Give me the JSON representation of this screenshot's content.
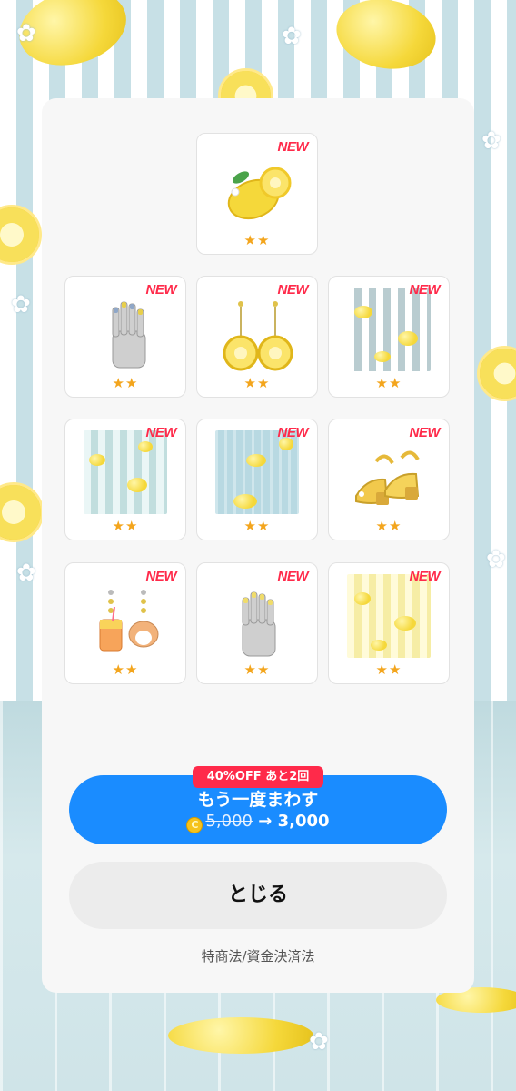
{
  "items": [
    {
      "badge": "NEW",
      "rarity": "★★",
      "icon": "lemon-icon"
    },
    {
      "badge": "NEW",
      "rarity": "★★",
      "icon": "nail-hand-icon"
    },
    {
      "badge": "NEW",
      "rarity": "★★",
      "icon": "lemon-earrings-icon"
    },
    {
      "badge": "NEW",
      "rarity": "★★",
      "icon": "striped-wallpaper-icon"
    },
    {
      "badge": "NEW",
      "rarity": "★★",
      "icon": "striped-wallpaper-teal-icon"
    },
    {
      "badge": "NEW",
      "rarity": "★★",
      "icon": "lemon-floor-icon"
    },
    {
      "badge": "NEW",
      "rarity": "★★",
      "icon": "yellow-sandals-icon"
    },
    {
      "badge": "NEW",
      "rarity": "★★",
      "icon": "drink-hamster-earrings-icon"
    },
    {
      "badge": "NEW",
      "rarity": "★★",
      "icon": "yellow-nail-hand-icon"
    },
    {
      "badge": "NEW",
      "rarity": "★★",
      "icon": "yellow-striped-wallpaper-icon"
    }
  ],
  "spin": {
    "badge": "40%OFF あと2回",
    "label": "もう一度まわす",
    "old_price": "5,000",
    "arrow": "→",
    "new_price": "3,000",
    "coin": "C"
  },
  "close_label": "とじる",
  "legal_link": "特商法/資金決済法",
  "colors": {
    "accent_blue": "#1a8cff",
    "badge_red": "#ff2a4a",
    "star": "#f3a51d"
  }
}
